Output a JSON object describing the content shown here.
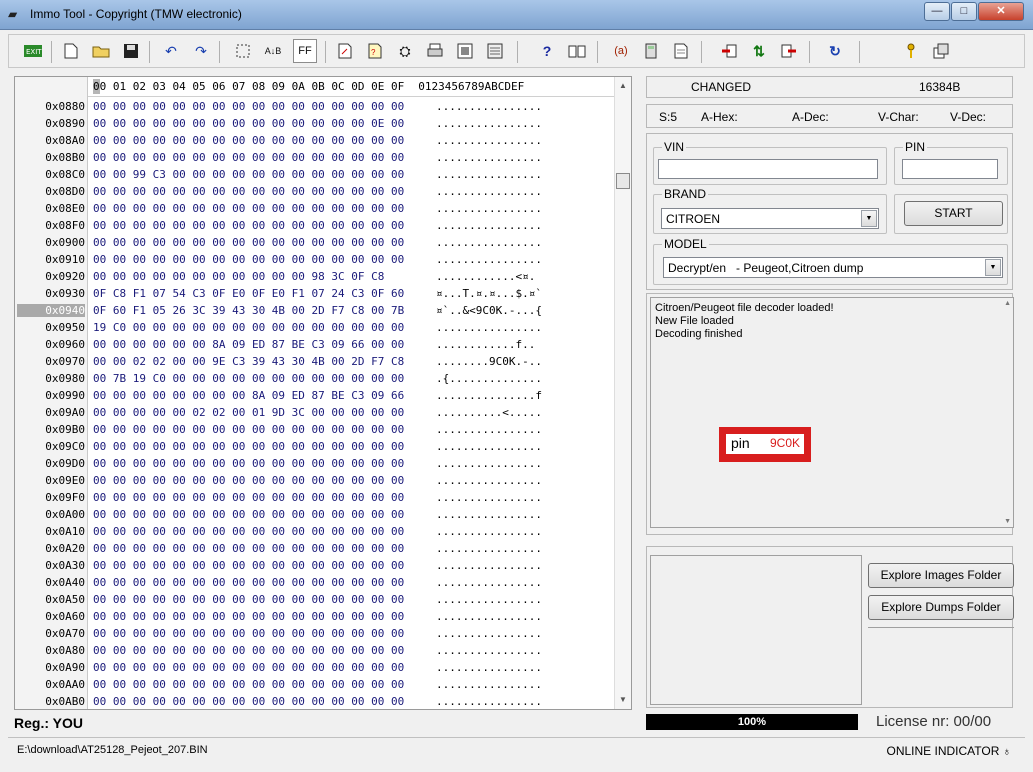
{
  "window": {
    "title": "Immo Tool - Copyright (TMW electronic)",
    "minimize": "—",
    "maximize": "□",
    "close": "✕"
  },
  "toolbar": {
    "ff_label": "FF",
    "help_label": "?",
    "var_label": "(a)"
  },
  "hex": {
    "header_bytes": "00 01 02 03 04 05 06 07 08 09 0A 0B 0C 0D 0E 0F",
    "header_ascii": "0123456789ABCDEF",
    "selected_addr": "0x0940",
    "rows": [
      {
        "addr": "0x0880",
        "bytes": "00 00 00 00 00 00 00 00 00 00 00 00 00 00 00 00",
        "ascii": "................"
      },
      {
        "addr": "0x0890",
        "bytes": "00 00 00 00 00 00 00 00 00 00 00 00 00 00 0E 00",
        "ascii": "................"
      },
      {
        "addr": "0x08A0",
        "bytes": "00 00 00 00 00 00 00 00 00 00 00 00 00 00 00 00",
        "ascii": "................"
      },
      {
        "addr": "0x08B0",
        "bytes": "00 00 00 00 00 00 00 00 00 00 00 00 00 00 00 00",
        "ascii": "................"
      },
      {
        "addr": "0x08C0",
        "bytes": "00 00 99 C3 00 00 00 00 00 00 00 00 00 00 00 00",
        "ascii": "................"
      },
      {
        "addr": "0x08D0",
        "bytes": "00 00 00 00 00 00 00 00 00 00 00 00 00 00 00 00",
        "ascii": "................"
      },
      {
        "addr": "0x08E0",
        "bytes": "00 00 00 00 00 00 00 00 00 00 00 00 00 00 00 00",
        "ascii": "................"
      },
      {
        "addr": "0x08F0",
        "bytes": "00 00 00 00 00 00 00 00 00 00 00 00 00 00 00 00",
        "ascii": "................"
      },
      {
        "addr": "0x0900",
        "bytes": "00 00 00 00 00 00 00 00 00 00 00 00 00 00 00 00",
        "ascii": "................"
      },
      {
        "addr": "0x0910",
        "bytes": "00 00 00 00 00 00 00 00 00 00 00 00 00 00 00 00",
        "ascii": "................"
      },
      {
        "addr": "0x0920",
        "bytes": "00 00 00 00 00 00 00 00 00 00 00 98 3C 0F C8",
        "ascii": "............<¤."
      },
      {
        "addr": "0x0930",
        "bytes": "0F C8 F1 07 54 C3 0F E0 0F E0 F1 07 24 C3 0F 60",
        "ascii": "¤...T.¤.¤...$.¤`"
      },
      {
        "addr": "0x0940",
        "bytes": "0F 60 F1 05 26 3C 39 43 30 4B 00 2D F7 C8 00 7B",
        "ascii": "¤`..&<9C0K.-...{"
      },
      {
        "addr": "0x0950",
        "bytes": "19 C0 00 00 00 00 00 00 00 00 00 00 00 00 00 00",
        "ascii": "................"
      },
      {
        "addr": "0x0960",
        "bytes": "00 00 00 00 00 00 8A 09 ED 87 BE C3 09 66 00 00",
        "ascii": "............f.."
      },
      {
        "addr": "0x0970",
        "bytes": "00 00 02 02 00 00 9E C3 39 43 30 4B 00 2D F7 C8",
        "ascii": "........9C0K.-.."
      },
      {
        "addr": "0x0980",
        "bytes": "00 7B 19 C0 00 00 00 00 00 00 00 00 00 00 00 00",
        "ascii": ".{.............."
      },
      {
        "addr": "0x0990",
        "bytes": "00 00 00 00 00 00 00 00 8A 09 ED 87 BE C3 09 66",
        "ascii": "...............f"
      },
      {
        "addr": "0x09A0",
        "bytes": "00 00 00 00 00 02 02 00 01 9D 3C 00 00 00 00 00",
        "ascii": "..........<....."
      },
      {
        "addr": "0x09B0",
        "bytes": "00 00 00 00 00 00 00 00 00 00 00 00 00 00 00 00",
        "ascii": "................"
      },
      {
        "addr": "0x09C0",
        "bytes": "00 00 00 00 00 00 00 00 00 00 00 00 00 00 00 00",
        "ascii": "................"
      },
      {
        "addr": "0x09D0",
        "bytes": "00 00 00 00 00 00 00 00 00 00 00 00 00 00 00 00",
        "ascii": "................"
      },
      {
        "addr": "0x09E0",
        "bytes": "00 00 00 00 00 00 00 00 00 00 00 00 00 00 00 00",
        "ascii": "................"
      },
      {
        "addr": "0x09F0",
        "bytes": "00 00 00 00 00 00 00 00 00 00 00 00 00 00 00 00",
        "ascii": "................"
      },
      {
        "addr": "0x0A00",
        "bytes": "00 00 00 00 00 00 00 00 00 00 00 00 00 00 00 00",
        "ascii": "................"
      },
      {
        "addr": "0x0A10",
        "bytes": "00 00 00 00 00 00 00 00 00 00 00 00 00 00 00 00",
        "ascii": "................"
      },
      {
        "addr": "0x0A20",
        "bytes": "00 00 00 00 00 00 00 00 00 00 00 00 00 00 00 00",
        "ascii": "................"
      },
      {
        "addr": "0x0A30",
        "bytes": "00 00 00 00 00 00 00 00 00 00 00 00 00 00 00 00",
        "ascii": "................"
      },
      {
        "addr": "0x0A40",
        "bytes": "00 00 00 00 00 00 00 00 00 00 00 00 00 00 00 00",
        "ascii": "................"
      },
      {
        "addr": "0x0A50",
        "bytes": "00 00 00 00 00 00 00 00 00 00 00 00 00 00 00 00",
        "ascii": "................"
      },
      {
        "addr": "0x0A60",
        "bytes": "00 00 00 00 00 00 00 00 00 00 00 00 00 00 00 00",
        "ascii": "................"
      },
      {
        "addr": "0x0A70",
        "bytes": "00 00 00 00 00 00 00 00 00 00 00 00 00 00 00 00",
        "ascii": "................"
      },
      {
        "addr": "0x0A80",
        "bytes": "00 00 00 00 00 00 00 00 00 00 00 00 00 00 00 00",
        "ascii": "................"
      },
      {
        "addr": "0x0A90",
        "bytes": "00 00 00 00 00 00 00 00 00 00 00 00 00 00 00 00",
        "ascii": "................"
      },
      {
        "addr": "0x0AA0",
        "bytes": "00 00 00 00 00 00 00 00 00 00 00 00 00 00 00 00",
        "ascii": "................"
      },
      {
        "addr": "0x0AB0",
        "bytes": "00 00 00 00 00 00 00 00 00 00 00 00 00 00 00 00",
        "ascii": "................"
      }
    ]
  },
  "status_panel": {
    "changed_label": "CHANGED",
    "size": "16384B",
    "s_label": "S:5",
    "a_hex_label": "A-Hex:",
    "a_dec_label": "A-Dec:",
    "v_char_label": "V-Char:",
    "v_dec_label": "V-Dec:"
  },
  "form": {
    "vin_label": "VIN",
    "vin_value": "",
    "pin_label": "PIN",
    "pin_value": "",
    "brand_label": "BRAND",
    "brand_value": "CITROEN",
    "start_button": "START",
    "model_label": "MODEL",
    "model_value": "Decrypt/en   - Peugeot,Citroen dump"
  },
  "log": {
    "lines": [
      "Citroen/Peugeot file decoder loaded!",
      "New File loaded",
      "Decoding finished"
    ],
    "pin_label": "pin",
    "pin_value": "9C0K"
  },
  "explore": {
    "images_button": "Explore Images Folder",
    "dumps_button": "Explore Dumps Folder"
  },
  "bottom": {
    "reg_label": "Reg.: YOU",
    "progress": "100%",
    "license": "License nr: 00/00",
    "path": "E:\\download\\AT25128_Pejeot_207.BIN",
    "online_indicator": "ONLINE INDICATOR"
  },
  "colors": {
    "hex_bytes": "#1a1a7a",
    "pin_highlight": "#d81e1e",
    "progress_bg": "#000000"
  }
}
